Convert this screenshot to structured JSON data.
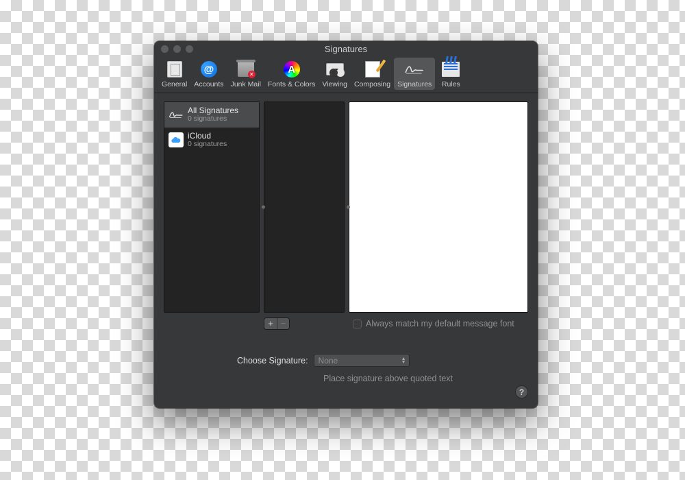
{
  "window": {
    "title": "Signatures"
  },
  "toolbar": {
    "items": [
      {
        "label": "General"
      },
      {
        "label": "Accounts"
      },
      {
        "label": "Junk Mail"
      },
      {
        "label": "Fonts & Colors"
      },
      {
        "label": "Viewing"
      },
      {
        "label": "Composing"
      },
      {
        "label": "Signatures"
      },
      {
        "label": "Rules"
      }
    ],
    "selected_index": 6
  },
  "accounts": [
    {
      "name": "All Signatures",
      "sub": "0 signatures",
      "selected": true,
      "icon": "signature"
    },
    {
      "name": "iCloud",
      "sub": "0 signatures",
      "selected": false,
      "icon": "icloud"
    }
  ],
  "buttons": {
    "add": "+",
    "remove": "−"
  },
  "checkboxes": {
    "match_font": "Always match my default message font",
    "place_above": "Place signature above quoted text"
  },
  "choose": {
    "label": "Choose Signature:",
    "value": "None"
  },
  "help": "?"
}
